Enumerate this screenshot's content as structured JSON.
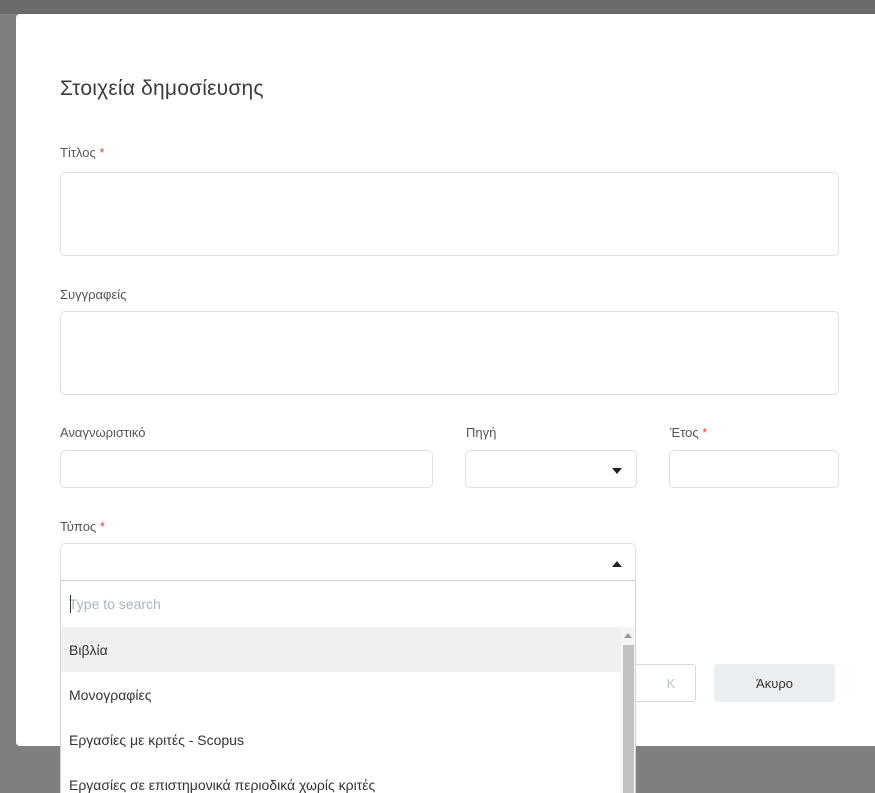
{
  "dialog": {
    "title": "Στοιχεία δημοσίευσης",
    "required_mark": "*",
    "fields": {
      "title": {
        "label": "Τίτλος",
        "value": ""
      },
      "authors": {
        "label": "Συγγραφείς",
        "value": ""
      },
      "identifier": {
        "label": "Αναγνωριστικό",
        "value": ""
      },
      "source": {
        "label": "Πηγή",
        "value": ""
      },
      "year": {
        "label": "Έτος",
        "value": ""
      },
      "type": {
        "label": "Τύπος",
        "value": ""
      }
    },
    "dropdown": {
      "search_placeholder": "Type to search",
      "options": [
        "Βιβλία",
        "Μονογραφίες",
        "Εργασίες με κριτές - Scopus",
        "Εργασίες σε επιστημονικά περιοδικά χωρίς κριτές"
      ],
      "highlighted_index": 0
    },
    "buttons": {
      "ok_label": "K",
      "cancel_label": "Άκυρο"
    }
  }
}
